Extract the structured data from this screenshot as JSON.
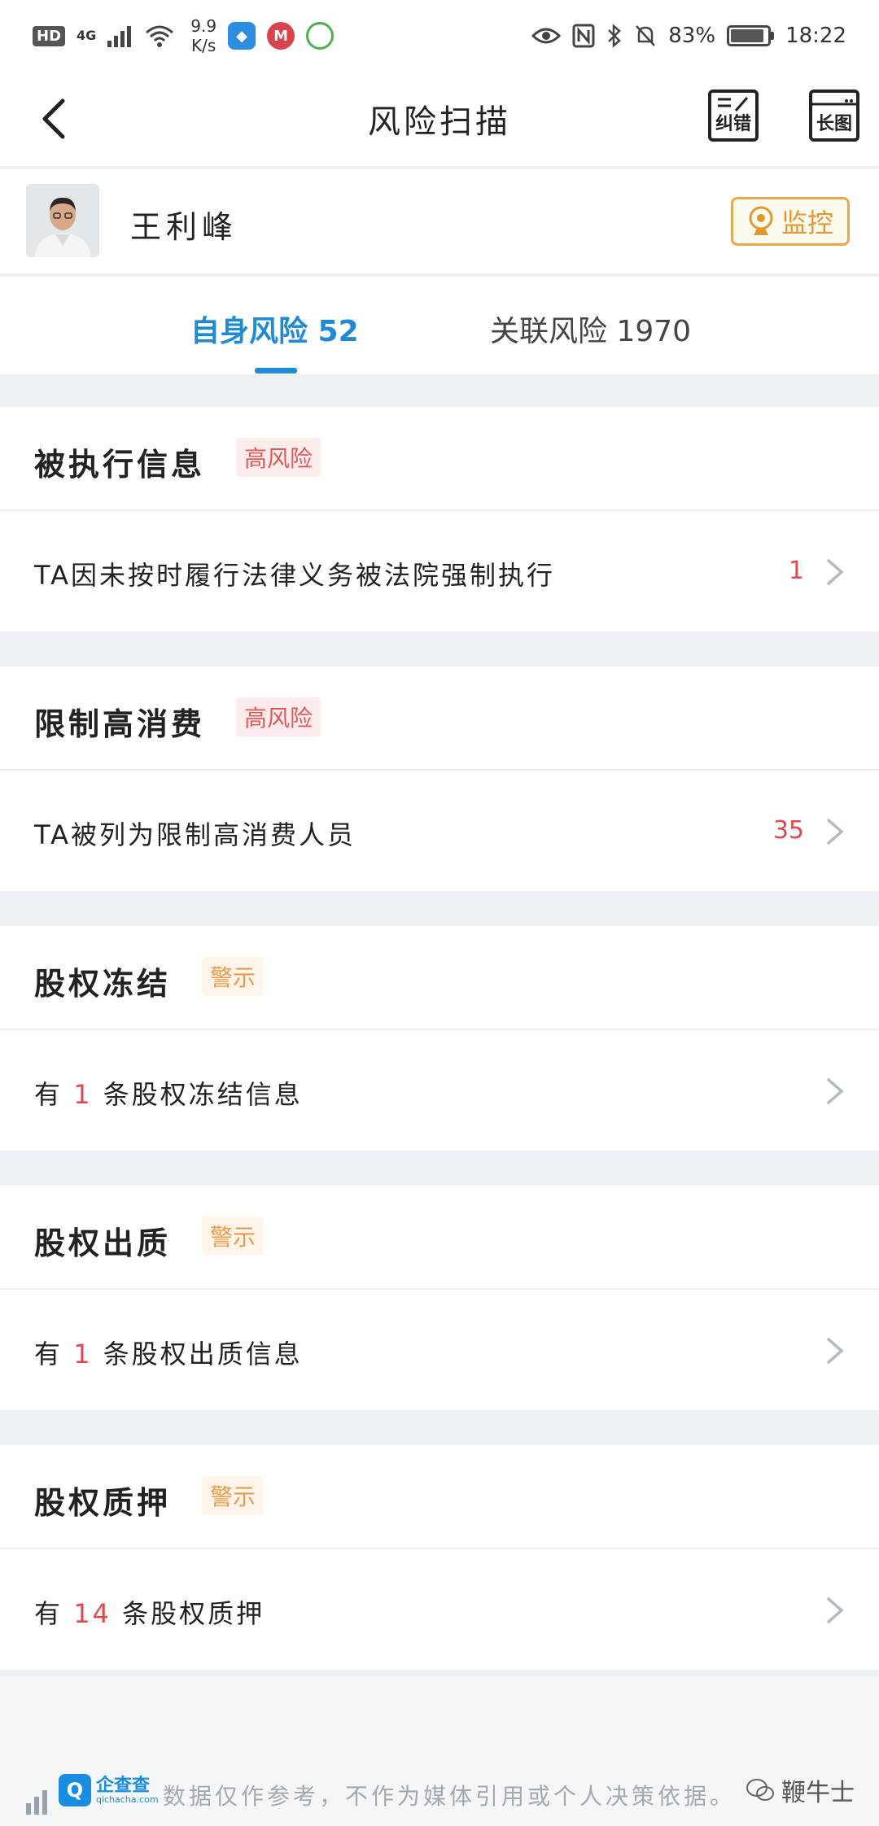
{
  "status_bar": {
    "hd": "HD",
    "network": "4G",
    "speed_value": "9.9",
    "speed_unit": "K/s",
    "battery": "83%",
    "time": "18:22",
    "battery_level": 0.83
  },
  "nav": {
    "title": "风险扫描",
    "fix_label": "纠错",
    "long_image_label": "长图"
  },
  "person": {
    "name": "王利峰",
    "monitor_label": "监控"
  },
  "tabs": {
    "self_label": "自身风险 52",
    "related_label": "关联风险 1970"
  },
  "sections": [
    {
      "title": "被执行信息",
      "tag": "高风险",
      "row": "TA因未按时履行法律义务被法院强制执行",
      "count": "1"
    },
    {
      "title": "限制高消费",
      "tag": "高风险",
      "row": "TA被列为限制高消费人员",
      "count": "35"
    },
    {
      "title": "股权冻结",
      "tag": "警示",
      "row_prefix": "有",
      "row_num": "1",
      "row_suffix": "条股权冻结信息"
    },
    {
      "title": "股权出质",
      "tag": "警示",
      "row_prefix": "有",
      "row_num": "1",
      "row_suffix": "条股权出质信息"
    },
    {
      "title": "股权质押",
      "tag": "警示",
      "row_prefix": "有",
      "row_num": "14",
      "row_suffix": "条股权质押"
    }
  ],
  "footer": {
    "brand_cn": "企查查",
    "brand_en": "qichacha.com",
    "disclaimer": "数据仅作参考，不作为媒体引用或个人决策依据。",
    "watermark": "鞭牛士"
  },
  "colors": {
    "accent": "#1f8ad6",
    "danger": "#e0494f",
    "warning": "#ec9a4a",
    "monitor": "#e3982d"
  },
  "icons": {
    "back": "chevron-left-icon",
    "fix": "edit-note-icon",
    "long_image": "long-image-icon",
    "monitor": "camera-icon",
    "row": "chevron-right-icon"
  }
}
